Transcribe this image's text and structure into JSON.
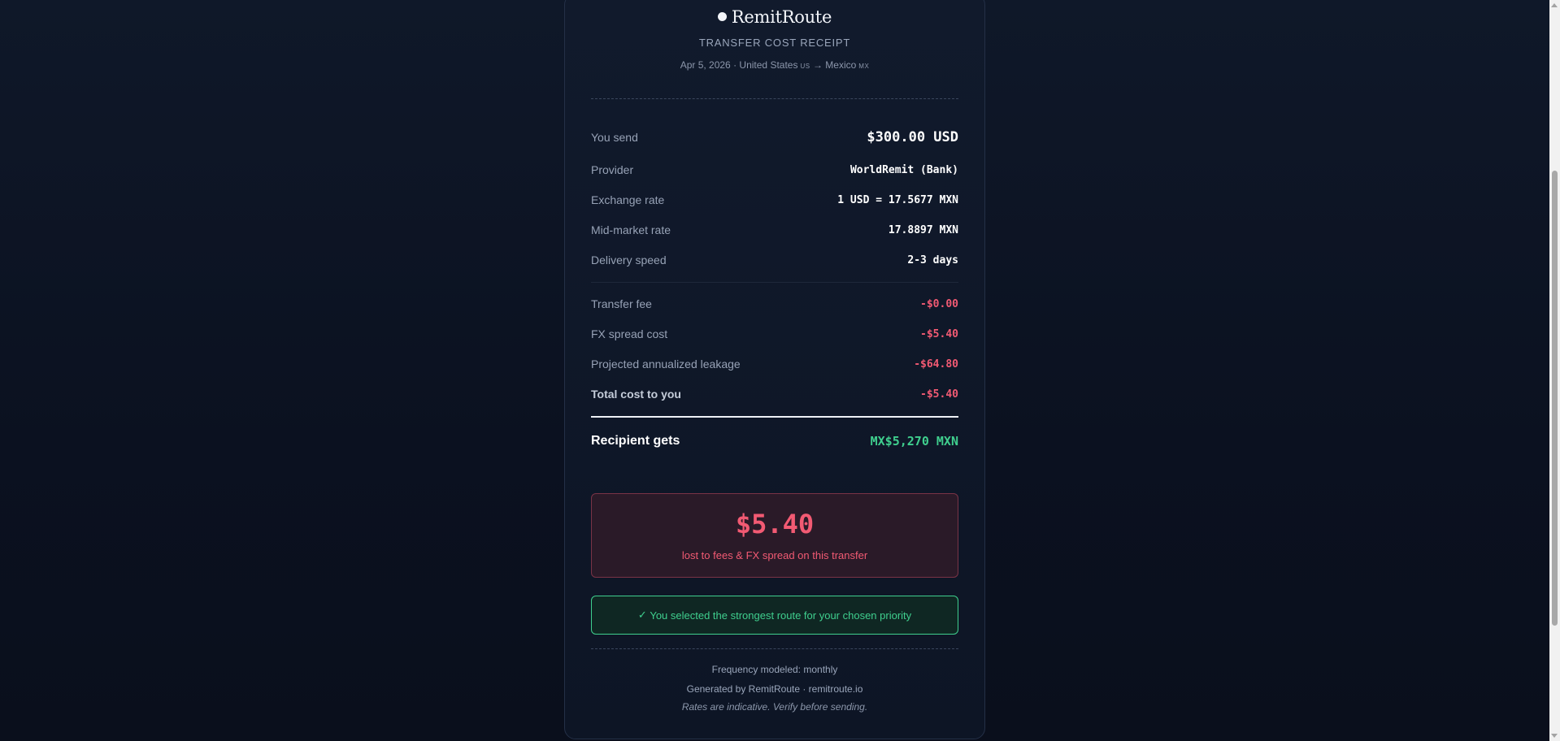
{
  "receipt": {
    "brand": "RemitRoute",
    "title": "TRANSFER COST RECEIPT",
    "date": "Apr 5, 2026",
    "separator": "·",
    "origin": "United States",
    "origin_code": "US",
    "arrow": "→",
    "destination": "Mexico",
    "destination_code": "MX"
  },
  "details": [
    {
      "label": "You send",
      "value": "$300.00 USD"
    },
    {
      "label": "Provider",
      "value": "WorldRemit (Bank)"
    },
    {
      "label": "Exchange rate",
      "value": "1 USD = 17.5677 MXN"
    },
    {
      "label": "Mid-market rate",
      "value": "17.8897 MXN"
    },
    {
      "label": "Delivery speed",
      "value": "2-3 days"
    }
  ],
  "costs": [
    {
      "label": "Transfer fee",
      "value": "-$0.00"
    },
    {
      "label": "FX spread cost",
      "value": "-$5.40"
    },
    {
      "label": "Projected annualized leakage",
      "value": "-$64.80"
    },
    {
      "label": "Total cost to you",
      "value": "-$5.40"
    }
  ],
  "recipient": {
    "label": "Recipient gets",
    "value": "MX$5,270 MXN"
  },
  "loss": {
    "amount": "$5.40",
    "caption": "lost to fees & FX spread on this transfer"
  },
  "verdict": {
    "check": "✓",
    "text": "You selected the strongest route for your chosen priority"
  },
  "footer": {
    "frequency": "Frequency modeled: monthly",
    "generated": "Generated by RemitRoute · remitroute.io",
    "disclaimer": "Rates are indicative. Verify before sending."
  },
  "colors": {
    "background": "#0b1120",
    "card": "#111a2c",
    "negative": "#f25a73",
    "positive": "#3fcf8e"
  }
}
